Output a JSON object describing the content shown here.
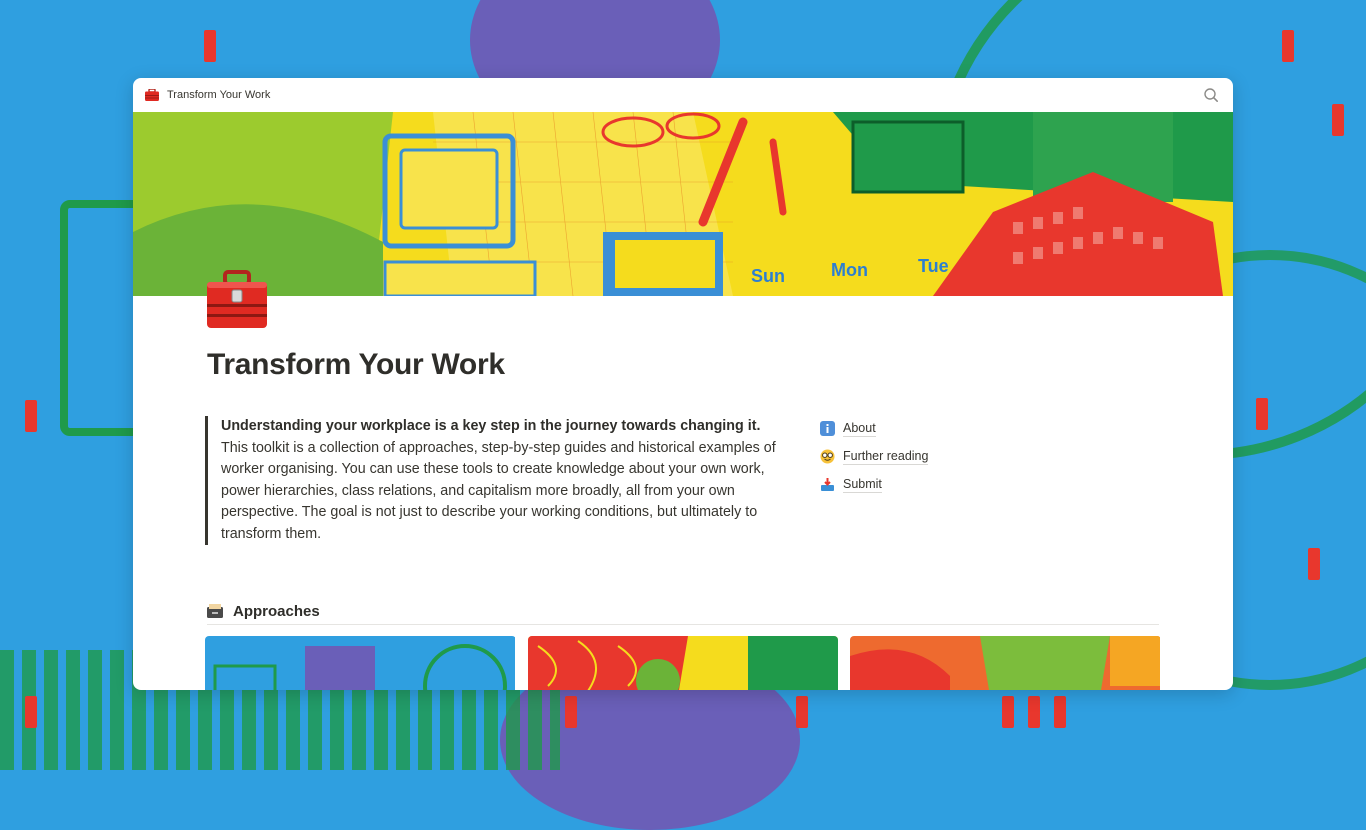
{
  "window": {
    "title": "Transform Your Work",
    "page_icon": "toolbox-icon",
    "search_icon": "search-icon"
  },
  "cover": {
    "day_labels": [
      "Sun",
      "Mon",
      "Tue"
    ]
  },
  "page": {
    "title": "Transform Your Work",
    "intro_bold": "Understanding your workplace is a key step in the journey towards changing it.",
    "intro_rest": " This toolkit is a collection of approaches, step-by-step guides and historical examples of worker organising. You can use these tools to create knowledge about your own work, power hierarchies, class relations, and capitalism more broadly, all from your own perspective. The goal is not just to describe your working conditions, but ultimately to transform them."
  },
  "links": [
    {
      "icon": "info-icon",
      "label": "About"
    },
    {
      "icon": "nerd-face-icon",
      "label": "Further reading"
    },
    {
      "icon": "inbox-tray-icon",
      "label": "Submit"
    }
  ],
  "section": {
    "icon": "card-file-box-icon",
    "label": "Approaches"
  },
  "colors": {
    "background": "#2f9fe0",
    "accent_red": "#e8372d",
    "accent_green": "#1f9a4a",
    "accent_yellow": "#f5dc1d",
    "text": "#37352f"
  }
}
